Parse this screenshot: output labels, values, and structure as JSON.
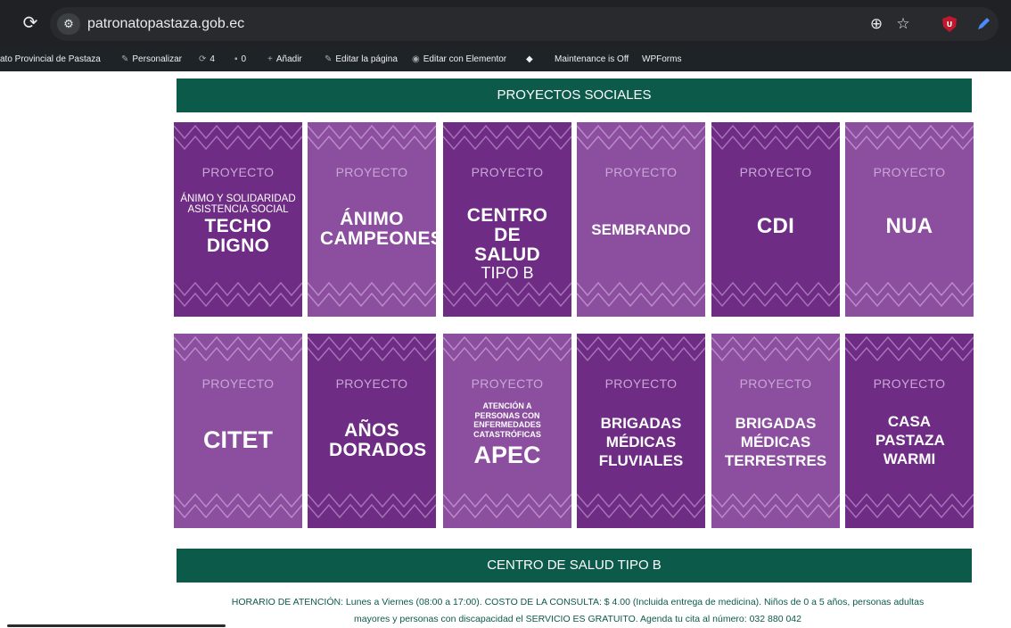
{
  "browser": {
    "url": "patronatopastaza.gob.ec"
  },
  "adminbar": {
    "site_name": "ato Provincial de Pastaza",
    "customize": "Personalizar",
    "updates_count": "4",
    "comments_count": "0",
    "add_new": "Añadir",
    "edit_page": "Editar la página",
    "edit_elementor": "Editar con Elementor",
    "maintenance": "Maintenance is Off",
    "wpforms": "WPForms"
  },
  "section1": {
    "title": "PROYECTOS SOCIALES"
  },
  "cards": [
    {
      "label": "PROYECTO",
      "sub": "ÁNIMO Y SOLIDARIDAD ASISTENCIA SOCIAL",
      "title": "TECHO DIGNO"
    },
    {
      "label": "PROYECTO",
      "title": "ÁNIMO CAMPEONES"
    },
    {
      "label": "PROYECTO",
      "title": "CENTRO DE SALUD",
      "subtitle": "TIPO B"
    },
    {
      "label": "PROYECTO",
      "title": "SEMBRANDO"
    },
    {
      "label": "PROYECTO",
      "title": "CDI"
    },
    {
      "label": "PROYECTO",
      "title": "NUA"
    },
    {
      "label": "PROYECTO",
      "title": "CITET"
    },
    {
      "label": "PROYECTO",
      "title": "AÑOS DORADOS"
    },
    {
      "label": "PROYECTO",
      "sub": "ATENCIÓN A PERSONAS CON ENFERMEDADES CATASTRÓFICAS",
      "title": "APEC"
    },
    {
      "label": "PROYECTO",
      "title": "BRIGADAS MÉDICAS FLUVIALES"
    },
    {
      "label": "PROYECTO",
      "title": "BRIGADAS MÉDICAS TERRESTRES"
    },
    {
      "label": "PROYECTO",
      "title": "CASA PASTAZA WARMI"
    }
  ],
  "section2": {
    "title": "CENTRO DE SALUD TIPO B",
    "info_line1": "HORARIO DE ATENCIÓN: Lunes a Viernes  (08:00 a 17:00). COSTO DE LA CONSULTA: $ 4.00 (Incluida entrega de medicina). Niños de 0 a 5 años, personas adultas",
    "info_line2": "mayores y personas con discapacidad el SERVICIO ES GRATUITO. Agenda tu cita al número: 032 880 042"
  },
  "colors": {
    "dark_purple": "#6e2c84",
    "light_purple": "#8c4f9f",
    "green": "#0b5a4a"
  }
}
